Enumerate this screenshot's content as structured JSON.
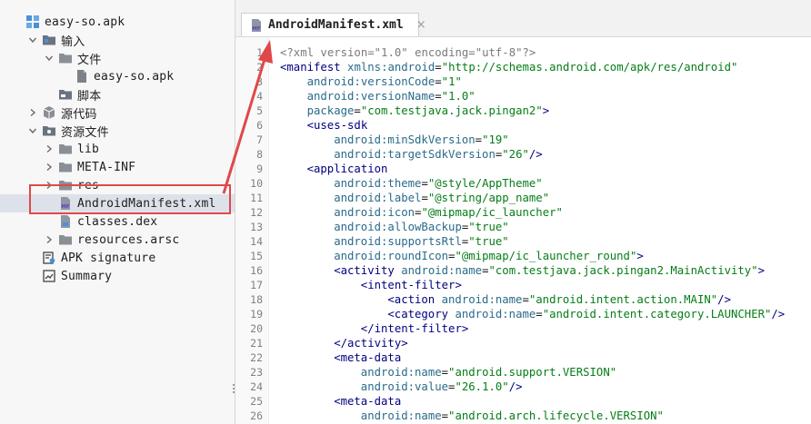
{
  "tree": {
    "items": [
      {
        "label": "easy-so.apk",
        "arrow": "none",
        "icon": "apk-icon",
        "indent": 0
      },
      {
        "label": "输入",
        "arrow": "down",
        "icon": "input-folder-icon",
        "indent": 1
      },
      {
        "label": "文件",
        "arrow": "down",
        "icon": "folder-icon",
        "indent": 2
      },
      {
        "label": "easy-so.apk",
        "arrow": "none",
        "icon": "file-icon",
        "indent": 3
      },
      {
        "label": "脚本",
        "arrow": "none",
        "icon": "script-folder-icon",
        "indent": 2
      },
      {
        "label": "源代码",
        "arrow": "right",
        "icon": "package-icon",
        "indent": 1
      },
      {
        "label": "资源文件",
        "arrow": "down",
        "icon": "resources-folder-icon",
        "indent": 1
      },
      {
        "label": "lib",
        "arrow": "right",
        "icon": "folder-icon",
        "indent": 2
      },
      {
        "label": "META-INF",
        "arrow": "right",
        "icon": "folder-icon",
        "indent": 2
      },
      {
        "label": "res",
        "arrow": "right",
        "icon": "folder-icon",
        "indent": 2
      },
      {
        "label": "AndroidManifest.xml",
        "arrow": "none",
        "icon": "manifest-file-icon",
        "indent": 2
      },
      {
        "label": "classes.dex",
        "arrow": "none",
        "icon": "dex-file-icon",
        "indent": 2
      },
      {
        "label": "resources.arsc",
        "arrow": "right",
        "icon": "folder-icon",
        "indent": 2
      },
      {
        "label": "APK signature",
        "arrow": "none",
        "icon": "signature-icon",
        "indent": 1
      },
      {
        "label": "Summary",
        "arrow": "none",
        "icon": "summary-icon",
        "indent": 1
      }
    ],
    "selected_index": 10
  },
  "editor": {
    "tab": {
      "label": "AndroidManifest.xml",
      "icon": "manifest-file-icon",
      "close": "×"
    },
    "line_numbers": [
      "1",
      "2",
      "3",
      "4",
      "5",
      "6",
      "7",
      "8",
      "9",
      "10",
      "11",
      "12",
      "13",
      "14",
      "15",
      "16",
      "17",
      "18",
      "19",
      "20",
      "21",
      "22",
      "23",
      "24",
      "25",
      "26"
    ],
    "lines": [
      {
        "indent": 0,
        "parts": [
          [
            "pi",
            "<?xml version=\"1.0\" encoding=\"utf-8\"?>"
          ]
        ]
      },
      {
        "indent": 0,
        "parts": [
          [
            "tag",
            "<manifest"
          ],
          [
            "plain",
            " "
          ],
          [
            "attr",
            "xmlns:android"
          ],
          [
            "plain",
            "="
          ],
          [
            "str",
            "\"http://schemas.android.com/apk/res/android\""
          ]
        ]
      },
      {
        "indent": 4,
        "parts": [
          [
            "attr",
            "android:versionCode"
          ],
          [
            "plain",
            "="
          ],
          [
            "str",
            "\"1\""
          ]
        ]
      },
      {
        "indent": 4,
        "parts": [
          [
            "attr",
            "android:versionName"
          ],
          [
            "plain",
            "="
          ],
          [
            "str",
            "\"1.0\""
          ]
        ]
      },
      {
        "indent": 4,
        "parts": [
          [
            "attr",
            "package"
          ],
          [
            "plain",
            "="
          ],
          [
            "str",
            "\"com.testjava.jack.pingan2\""
          ],
          [
            "tag",
            ">"
          ]
        ]
      },
      {
        "indent": 4,
        "parts": [
          [
            "tag",
            "<uses-sdk"
          ]
        ]
      },
      {
        "indent": 8,
        "parts": [
          [
            "attr",
            "android:minSdkVersion"
          ],
          [
            "plain",
            "="
          ],
          [
            "str",
            "\"19\""
          ]
        ]
      },
      {
        "indent": 8,
        "parts": [
          [
            "attr",
            "android:targetSdkVersion"
          ],
          [
            "plain",
            "="
          ],
          [
            "str",
            "\"26\""
          ],
          [
            "tag",
            "/>"
          ]
        ]
      },
      {
        "indent": 4,
        "parts": [
          [
            "tag",
            "<application"
          ]
        ]
      },
      {
        "indent": 8,
        "parts": [
          [
            "attr",
            "android:theme"
          ],
          [
            "plain",
            "="
          ],
          [
            "str",
            "\"@style/AppTheme\""
          ]
        ]
      },
      {
        "indent": 8,
        "parts": [
          [
            "attr",
            "android:label"
          ],
          [
            "plain",
            "="
          ],
          [
            "str",
            "\"@string/app_name\""
          ]
        ]
      },
      {
        "indent": 8,
        "parts": [
          [
            "attr",
            "android:icon"
          ],
          [
            "plain",
            "="
          ],
          [
            "str",
            "\"@mipmap/ic_launcher\""
          ]
        ]
      },
      {
        "indent": 8,
        "parts": [
          [
            "attr",
            "android:allowBackup"
          ],
          [
            "plain",
            "="
          ],
          [
            "str",
            "\"true\""
          ]
        ]
      },
      {
        "indent": 8,
        "parts": [
          [
            "attr",
            "android:supportsRtl"
          ],
          [
            "plain",
            "="
          ],
          [
            "str",
            "\"true\""
          ]
        ]
      },
      {
        "indent": 8,
        "parts": [
          [
            "attr",
            "android:roundIcon"
          ],
          [
            "plain",
            "="
          ],
          [
            "str",
            "\"@mipmap/ic_launcher_round\""
          ],
          [
            "tag",
            ">"
          ]
        ]
      },
      {
        "indent": 8,
        "parts": [
          [
            "tag",
            "<activity"
          ],
          [
            "plain",
            " "
          ],
          [
            "attr",
            "android:name"
          ],
          [
            "plain",
            "="
          ],
          [
            "str",
            "\"com.testjava.jack.pingan2.MainActivity\""
          ],
          [
            "tag",
            ">"
          ]
        ]
      },
      {
        "indent": 12,
        "parts": [
          [
            "tag",
            "<intent-filter>"
          ]
        ]
      },
      {
        "indent": 16,
        "parts": [
          [
            "tag",
            "<action"
          ],
          [
            "plain",
            " "
          ],
          [
            "attr",
            "android:name"
          ],
          [
            "plain",
            "="
          ],
          [
            "str",
            "\"android.intent.action.MAIN\""
          ],
          [
            "tag",
            "/>"
          ]
        ]
      },
      {
        "indent": 16,
        "parts": [
          [
            "tag",
            "<category"
          ],
          [
            "plain",
            " "
          ],
          [
            "attr",
            "android:name"
          ],
          [
            "plain",
            "="
          ],
          [
            "str",
            "\"android.intent.category.LAUNCHER\""
          ],
          [
            "tag",
            "/>"
          ]
        ]
      },
      {
        "indent": 12,
        "parts": [
          [
            "tag",
            "</intent-filter>"
          ]
        ]
      },
      {
        "indent": 8,
        "parts": [
          [
            "tag",
            "</activity>"
          ]
        ]
      },
      {
        "indent": 8,
        "parts": [
          [
            "tag",
            "<meta-data"
          ]
        ]
      },
      {
        "indent": 12,
        "parts": [
          [
            "attr",
            "android:name"
          ],
          [
            "plain",
            "="
          ],
          [
            "str",
            "\"android.support.VERSION\""
          ]
        ]
      },
      {
        "indent": 12,
        "parts": [
          [
            "attr",
            "android:value"
          ],
          [
            "plain",
            "="
          ],
          [
            "str",
            "\"26.1.0\""
          ],
          [
            "tag",
            "/>"
          ]
        ]
      },
      {
        "indent": 8,
        "parts": [
          [
            "tag",
            "<meta-data"
          ]
        ]
      },
      {
        "indent": 12,
        "parts": [
          [
            "attr",
            "android:name"
          ],
          [
            "plain",
            "="
          ],
          [
            "str",
            "\"android.arch.lifecycle.VERSION\""
          ]
        ]
      }
    ]
  },
  "colors": {
    "annotation": "#e04848",
    "selection": "#dde2ea",
    "tag": "#000080",
    "attribute": "#2a6b8a",
    "string": "#067d17"
  }
}
